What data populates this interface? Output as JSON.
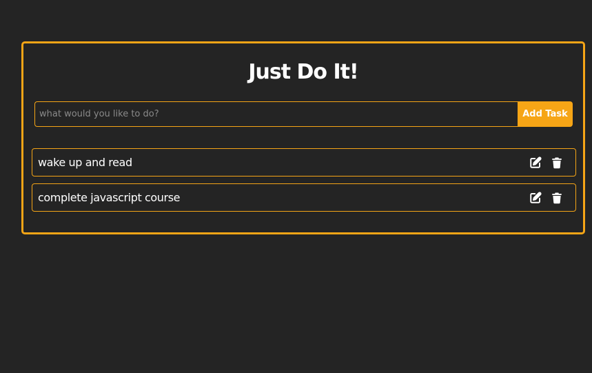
{
  "app": {
    "title": "Just Do It!"
  },
  "input": {
    "placeholder": "what would you like to do?",
    "value": ""
  },
  "add_button": {
    "label": "Add Task"
  },
  "tasks": [
    {
      "text": "wake up and read",
      "edit_icon": "edit-icon",
      "delete_icon": "trash-icon"
    },
    {
      "text": "complete javascript course",
      "edit_icon": "edit-icon",
      "delete_icon": "trash-icon"
    }
  ],
  "colors": {
    "background": "#242424",
    "accent": "#f6a516",
    "text": "#ffffff",
    "placeholder": "#8a8a8a"
  }
}
